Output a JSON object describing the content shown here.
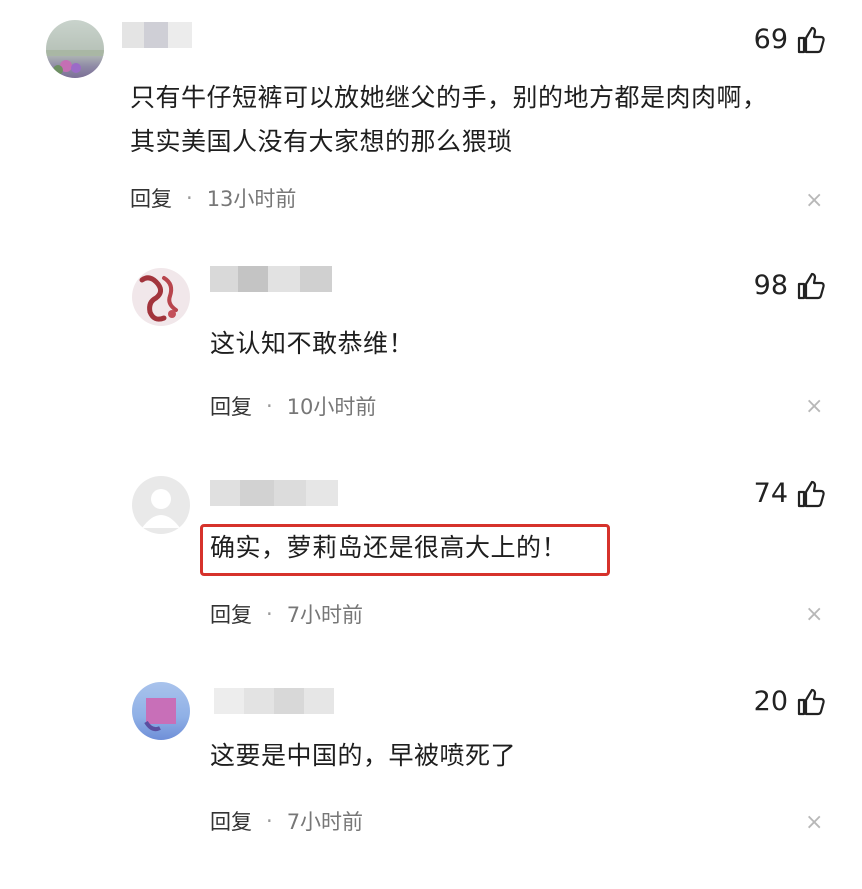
{
  "comments": [
    {
      "likes": "69",
      "lines": [
        "只有牛仔短裤可以放她继父的手，别的地方都是肉肉啊，",
        "其实美国人没有大家想的那么猥琐"
      ],
      "reply": "回复",
      "dot": "·",
      "time": "13小时前"
    },
    {
      "likes": "98",
      "lines": [
        "这认知不敢恭维！"
      ],
      "reply": "回复",
      "dot": "·",
      "time": "10小时前"
    },
    {
      "likes": "74",
      "lines": [
        "确实，萝莉岛还是很高大上的！"
      ],
      "reply": "回复",
      "dot": "·",
      "time": "7小时前"
    },
    {
      "likes": "20",
      "lines": [
        "这要是中国的，早被喷死了"
      ],
      "reply": "回复",
      "dot": "·",
      "time": "7小时前"
    }
  ],
  "close_glyph": "×",
  "colors": {
    "highlight_border": "#d6322b",
    "meta_text": "#777777"
  }
}
